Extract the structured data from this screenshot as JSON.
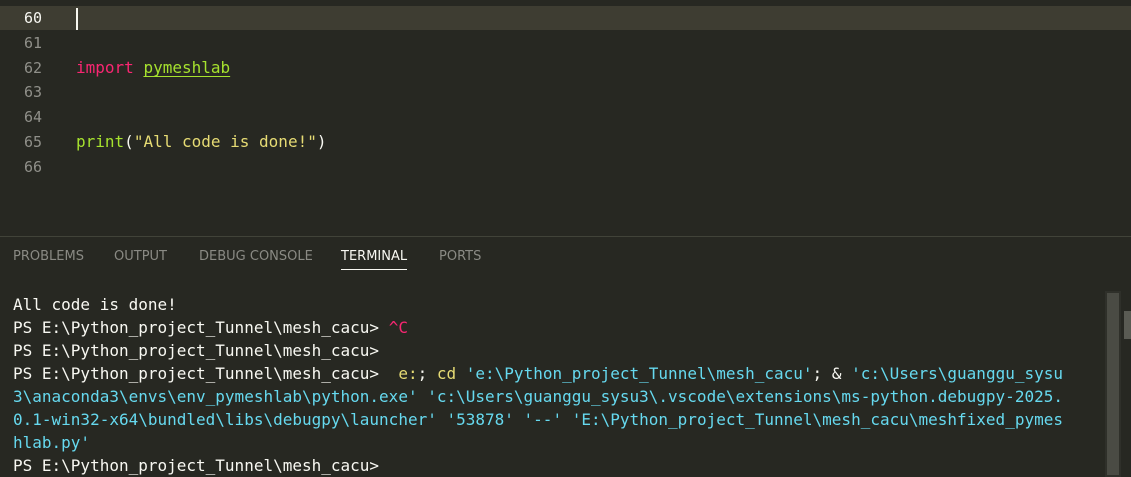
{
  "editor": {
    "lines": [
      {
        "num": "60"
      },
      {
        "num": "61"
      },
      {
        "num": "62",
        "keyword": "import",
        "module": "pymeshlab"
      },
      {
        "num": "63"
      },
      {
        "num": "64"
      },
      {
        "num": "65",
        "func": "print",
        "open": "(",
        "string": "\"All code is done!\"",
        "close": ")"
      },
      {
        "num": "66"
      }
    ]
  },
  "panel": {
    "tabs": [
      {
        "label": "PROBLEMS"
      },
      {
        "label": "OUTPUT"
      },
      {
        "label": "DEBUG CONSOLE"
      },
      {
        "label": "TERMINAL",
        "active": true
      },
      {
        "label": "PORTS"
      }
    ]
  },
  "terminal": {
    "output1": "All code is done!",
    "prompt": "PS E:\\Python_project_Tunnel\\mesh_cacu> ",
    "interrupt": "^C",
    "cmd_e": "e:",
    "cmd_semicolon1": "; ",
    "cmd_cd": "cd",
    "cmd_path": "'e:\\Python_project_Tunnel\\mesh_cacu'",
    "cmd_amp": "; & ",
    "cmd_arg1_part1": "'c:\\Users\\guanggu_sysu",
    "cmd_arg1_part2": "3\\anaconda3\\envs\\env_pymeshlab\\python.exe'",
    "cmd_arg2_part1": " 'c:\\Users\\guanggu_sysu3\\.vscode\\extensions\\ms-python.debugpy-2025.",
    "cmd_arg2_part2": "0.1-win32-x64\\bundled\\libs\\debugpy\\launcher'",
    "cmd_port": " '53878'",
    "cmd_dashes": " '--'",
    "cmd_file_part1": " 'E:\\Python_project_Tunnel\\mesh_cacu\\meshfixed_pymes",
    "cmd_file_part2": "hlab.py'"
  },
  "colors": {
    "background": "#272822",
    "current_line": "#3e3d32",
    "keyword": "#f92672",
    "function": "#a6e22e",
    "string": "#e6db74",
    "cyan": "#66d9ef"
  }
}
